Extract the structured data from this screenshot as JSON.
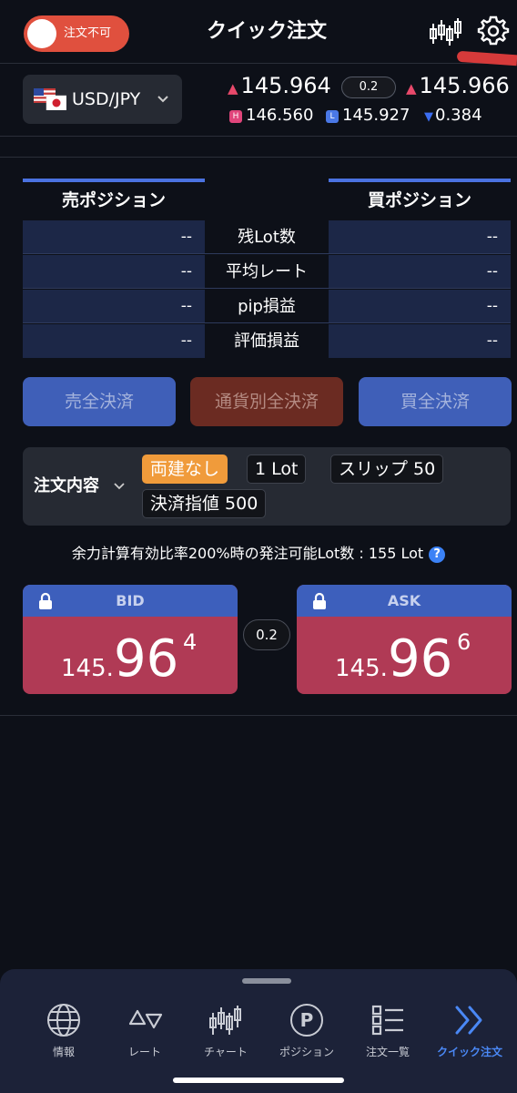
{
  "header": {
    "toggle_label": "注文不可",
    "title": "クイック注文"
  },
  "rate": {
    "pair": "USD/JPY",
    "bid": "145.964",
    "spread": "0.2",
    "ask": "145.966",
    "high_badge": "H",
    "high": "146.560",
    "low_badge": "L",
    "low": "145.927",
    "change": "0.384"
  },
  "positions": {
    "sell_header": "売ポジション",
    "buy_header": "買ポジション",
    "rows": [
      {
        "label": "残Lot数",
        "sell": "--",
        "buy": "--"
      },
      {
        "label": "平均レート",
        "sell": "--",
        "buy": "--"
      },
      {
        "label": "pip損益",
        "sell": "--",
        "buy": "--"
      },
      {
        "label": "評価損益",
        "sell": "--",
        "buy": "--"
      }
    ]
  },
  "close_buttons": {
    "sell_all": "売全決済",
    "by_currency": "通貨別全決済",
    "buy_all": "買全決済"
  },
  "order": {
    "label": "注文内容",
    "chips": [
      "両建なし",
      "1 Lot",
      "スリップ 50",
      "決済指値 500"
    ]
  },
  "available_text": "余力計算有効比率200%時の発注可能Lot数 : 155 Lot",
  "help_glyph": "?",
  "trade": {
    "bid_label": "BID",
    "bid_small": "145.",
    "bid_big": "96",
    "bid_sup": "4",
    "spread": "0.2",
    "ask_label": "ASK",
    "ask_small": "145.",
    "ask_big": "96",
    "ask_sup": "6"
  },
  "nav": {
    "items": [
      {
        "label": "情報",
        "icon": "globe-icon"
      },
      {
        "label": "レート",
        "icon": "rate-arrows-icon"
      },
      {
        "label": "チャート",
        "icon": "candlestick-icon"
      },
      {
        "label": "ポジション",
        "icon": "position-p-icon"
      },
      {
        "label": "注文一覧",
        "icon": "order-list-icon"
      },
      {
        "label": "クイック注文",
        "icon": "quick-order-icon"
      }
    ]
  },
  "colors": {
    "accent_blue": "#3d5fbc",
    "trade_red": "#b03a55",
    "toggle_red": "#e0503e",
    "chip_orange": "#f09b3b"
  }
}
